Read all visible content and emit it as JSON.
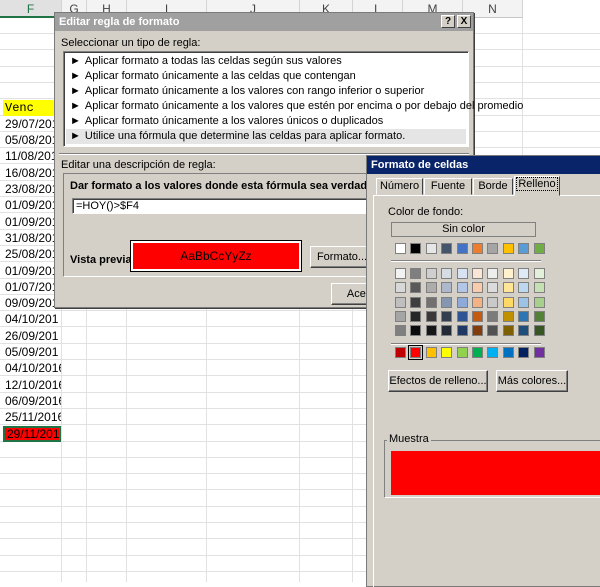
{
  "sheet": {
    "columns": [
      "F",
      "G",
      "H",
      "I",
      "J",
      "K",
      "L",
      "M",
      "N"
    ],
    "selected_column": "F",
    "header_cell": "Venc",
    "dates": [
      "29/07/201",
      "05/08/201",
      "11/08/201",
      "16/08/201",
      "23/08/201",
      "01/09/201",
      "01/09/201",
      "31/08/201",
      "25/08/201",
      "01/09/201",
      "01/07/201",
      "09/09/201",
      "04/10/201",
      "26/09/201",
      "05/09/201",
      "04/10/2016",
      "12/10/2016",
      "06/09/2016",
      "25/11/2016",
      "29/11/2016"
    ],
    "highlighted_index": 19,
    "header_fill": "#ffff00",
    "highlight_fill": "#ff0000"
  },
  "rule_dialog": {
    "title": "Editar regla de formato",
    "help_glyph": "?",
    "close_glyph": "X",
    "select_label": "Seleccionar un tipo de regla:",
    "rule_bullet": "►",
    "rule_types": [
      "Aplicar formato a todas las celdas según sus valores",
      "Aplicar formato únicamente a las celdas que contengan",
      "Aplicar formato únicamente a los valores con rango inferior o superior",
      "Aplicar formato únicamente a los valores que estén por encima o por debajo del promedio",
      "Aplicar formato únicamente a los valores únicos o duplicados",
      "Utilice una fórmula que determine las celdas para aplicar formato."
    ],
    "selected_rule": 5,
    "edit_label": "Editar una descripción de regla:",
    "formula_label": "Dar formato a los valores donde esta fórmula sea verdadera:",
    "formula_value": "=HOY()>$F4",
    "preview_label": "Vista previa:",
    "preview_text": "AaBbCcYyZz",
    "preview_fill": "#ff0000",
    "format_button": "Formato...",
    "accept_button": "Acept",
    "title_color": "#a0a0a0"
  },
  "format_dialog": {
    "title": "Formato de celdas",
    "title_color": "#0a246a",
    "tabs": [
      "Número",
      "Fuente",
      "Borde",
      "Relleno"
    ],
    "active_tab": "Relleno",
    "bg_color_label": "Color de fondo:",
    "no_color": "Sin color",
    "theme_top_row": [
      "#ffffff",
      "#000000",
      "#e7e6e6",
      "#44546a",
      "#4472c4",
      "#ed7d31",
      "#a5a5a5",
      "#ffc000",
      "#5b9bd5",
      "#70ad47"
    ],
    "theme_shades": [
      [
        "#f2f2f2",
        "#7f7f7f",
        "#d0cece",
        "#d6dce4",
        "#d9e2f3",
        "#fbe5d5",
        "#ededed",
        "#fff2cc",
        "#deebf6",
        "#e2efd9"
      ],
      [
        "#d8d8d8",
        "#595959",
        "#aeabab",
        "#adb9ca",
        "#b4c6e7",
        "#f7cbac",
        "#dbdbdb",
        "#ffe598",
        "#bdd7ee",
        "#c5e0b3"
      ],
      [
        "#bfbfbf",
        "#3f3f3f",
        "#757070",
        "#8496b0",
        "#8eaadb",
        "#f4b183",
        "#c9c9c9",
        "#ffd965",
        "#9cc3e5",
        "#a8d08d"
      ],
      [
        "#a5a5a5",
        "#262626",
        "#3a3838",
        "#323f4f",
        "#2f5496",
        "#c55a11",
        "#7b7b7b",
        "#bf9000",
        "#2e75b5",
        "#538135"
      ],
      [
        "#7f7f7f",
        "#0c0c0c",
        "#171616",
        "#222a35",
        "#1f3864",
        "#833c0b",
        "#525252",
        "#7f6000",
        "#1e4e79",
        "#375623"
      ]
    ],
    "standard_colors": [
      "#c00000",
      "#ff0000",
      "#ffc000",
      "#ffff00",
      "#92d050",
      "#00b050",
      "#00b0f0",
      "#0070c0",
      "#002060",
      "#7030a0"
    ],
    "selected_standard": 1,
    "fill_effects_button": "Efectos de relleno...",
    "more_colors_button": "Más colores...",
    "sample_label": "Muestra",
    "sample_fill": "#ff0000"
  }
}
